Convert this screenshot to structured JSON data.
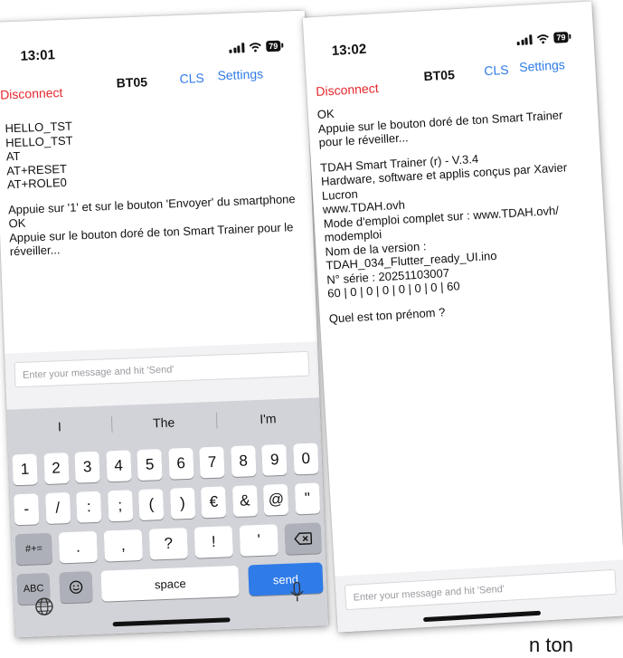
{
  "left_phone": {
    "time": "13:01",
    "battery": "79",
    "disconnect_label": "Disconnect",
    "device_name": "BT05",
    "cls_label": "CLS",
    "settings_label": "Settings",
    "log_lines": [
      "HELLO_TST",
      "HELLO_TST",
      "AT",
      "AT+RESET",
      "AT+ROLE0"
    ],
    "log_block2": [
      "Appuie sur '1' et sur le bouton 'Envoyer' du smartphone",
      "OK",
      "Appuie sur le bouton doré de ton Smart Trainer pour le réveiller..."
    ],
    "input_placeholder": "Enter your message and hit 'Send'",
    "keyboard": {
      "suggestions": [
        "I",
        "The",
        "I'm"
      ],
      "row1": [
        "1",
        "2",
        "3",
        "4",
        "5",
        "6",
        "7",
        "8",
        "9",
        "0"
      ],
      "row2": [
        "-",
        "/",
        ":",
        ";",
        "(",
        ")",
        "€",
        "&",
        "@",
        "\""
      ],
      "row3_left": "#+=",
      "row3": [
        ".",
        ",",
        "?",
        "!",
        "'"
      ],
      "abc_label": "ABC",
      "space_label": "space",
      "send_label": "send"
    }
  },
  "right_phone": {
    "time": "13:02",
    "battery": "79",
    "disconnect_label": "Disconnect",
    "device_name": "BT05",
    "cls_label": "CLS",
    "settings_label": "Settings",
    "log_block1": [
      "OK",
      "Appuie sur le bouton doré de ton Smart Trainer pour le réveiller..."
    ],
    "log_block2": [
      "TDAH Smart Trainer (r) - V.3.4",
      "Hardware, software et applis conçus par Xavier Lucron",
      "www.TDAH.ovh",
      "Mode d'emploi complet sur : www.TDAH.ovh/ modemploi",
      "Nom de la version :",
      "TDAH_034_Flutter_ready_UI.ino",
      "N° série : 20251103007",
      "60 | 0 | 0 | 0 | 0 | 0 | 0 | 60"
    ],
    "log_block3": [
      "Quel est ton prénom ?"
    ],
    "input_placeholder": "Enter your message and hit 'Send'"
  },
  "caption_fragment": "n ton"
}
